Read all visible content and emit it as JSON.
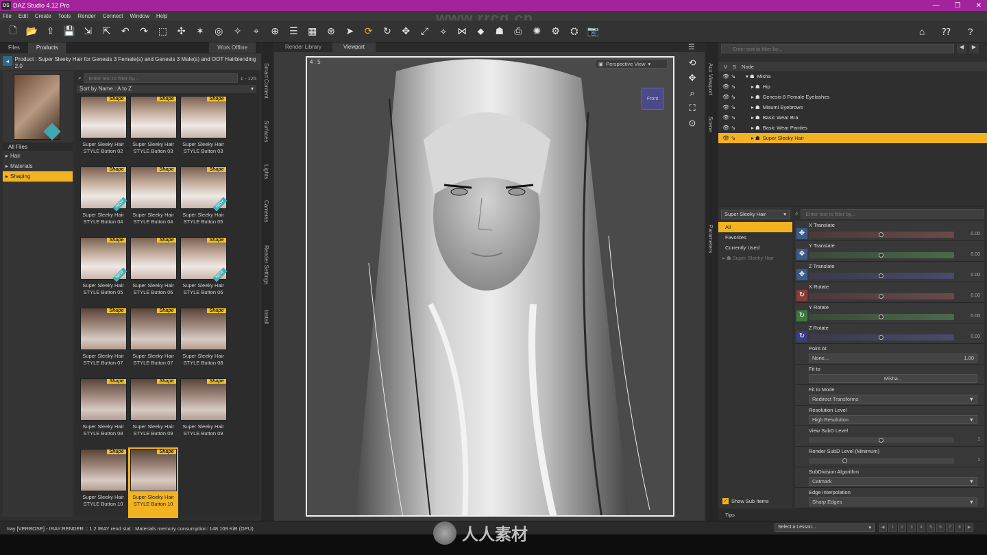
{
  "app": {
    "title": "DAZ Studio 4.12 Pro",
    "logo": "DS"
  },
  "window_controls": [
    "—",
    "❐",
    "✕"
  ],
  "menu": [
    "File",
    "Edit",
    "Create",
    "Tools",
    "Render",
    "Connect",
    "Window",
    "Help"
  ],
  "watermark_top": "www.rrcg.cn",
  "watermark_bottom": "人人素材",
  "left": {
    "tabs": [
      "Files",
      "Products",
      "Work Offline"
    ],
    "product_label": "Product :",
    "product_name": "Super Sleeky Hair for Genesis 3 Female(s) and Genesis 3 Male(s) and OOT Hairblending 2.0",
    "all_files": "All Files",
    "categories": [
      "Hair",
      "Materials",
      "Shaping"
    ],
    "filter_placeholder": "Enter text to filter by...",
    "count": "1 - 125",
    "sort": "Sort by Name : A to Z",
    "items": [
      {
        "label": "Super Sleeky Hair STYLE Button 02",
        "tag": "Shape",
        "new": false
      },
      {
        "label": "Super Sleeky Hair STYLE Button 03",
        "tag": "Shape",
        "new": false
      },
      {
        "label": "Super Sleeky Hair STYLE Button 03",
        "tag": "Shape",
        "new": false
      },
      {
        "label": "Super Sleeky Hair STYLE Button 04",
        "tag": "Shape",
        "new": true
      },
      {
        "label": "Super Sleeky Hair STYLE Button 04",
        "tag": "Shape",
        "new": false
      },
      {
        "label": "Super Sleeky Hair STYLE Button 05",
        "tag": "Shape",
        "new": true
      },
      {
        "label": "Super Sleeky Hair STYLE Button 05",
        "tag": "Shape",
        "new": true
      },
      {
        "label": "Super Sleeky Hair STYLE Button 06",
        "tag": "Shape",
        "new": false
      },
      {
        "label": "Super Sleeky Hair STYLE Button 06",
        "tag": "Shape",
        "new": true
      },
      {
        "label": "Super Sleeky Hair STYLE Button 07",
        "tag": "Shape",
        "new": false
      },
      {
        "label": "Super Sleeky Hair STYLE Button 07",
        "tag": "Shape",
        "new": false
      },
      {
        "label": "Super Sleeky Hair STYLE Button 08",
        "tag": "Shape",
        "new": false
      },
      {
        "label": "Super Sleeky Hair STYLE Button 08",
        "tag": "Shape",
        "new": false
      },
      {
        "label": "Super Sleeky Hair STYLE Button 09",
        "tag": "Shape",
        "new": false
      },
      {
        "label": "Super Sleeky Hair STYLE Button 09",
        "tag": "Shape",
        "new": false
      },
      {
        "label": "Super Sleeky Hair STYLE Button 10",
        "tag": "Shape",
        "new": false
      },
      {
        "label": "Super Sleeky Hair STYLE Button 10",
        "tag": "Shape",
        "new": false
      }
    ]
  },
  "side_tabs_left": [
    "Smart Content",
    "Surfaces",
    "Lights",
    "Cameras",
    "Render Settings",
    "Install"
  ],
  "viewport": {
    "tabs": [
      "Render Library",
      "Viewport"
    ],
    "ratio": "4 : 5",
    "view": "Perspective View",
    "cube_label": "Front"
  },
  "side_tabs_right": [
    "Aux Viewport",
    "Scene",
    "Parameters"
  ],
  "scene": {
    "filter_placeholder": "Enter text to filter by...",
    "header": [
      "V",
      "S",
      "Node"
    ],
    "nodes": [
      {
        "name": "Misha",
        "indent": 0,
        "selected": false
      },
      {
        "name": "Hip",
        "indent": 1,
        "selected": false
      },
      {
        "name": "Genesis 8 Female Eyelashes",
        "indent": 1,
        "selected": false
      },
      {
        "name": "Misumi Eyebrows",
        "indent": 1,
        "selected": false
      },
      {
        "name": "Basic Wear Bra",
        "indent": 1,
        "selected": false
      },
      {
        "name": "Basic Wear Panties",
        "indent": 1,
        "selected": false
      },
      {
        "name": "Super Sleeky Hair",
        "indent": 1,
        "selected": true
      }
    ]
  },
  "params": {
    "node_select": "Super Sleeky Hair",
    "groups": [
      "All",
      "Favorites",
      "Currently Used"
    ],
    "tree_node": "Super Sleeky Hair",
    "filter_placeholder": "Enter text to filter by...",
    "show_sub_items": "Show Sub Items",
    "props": [
      {
        "name": "X Translate",
        "kind": "slider",
        "icon": "translate",
        "track": "x",
        "value": "0.00",
        "knob": 0.5
      },
      {
        "name": "Y Translate",
        "kind": "slider",
        "icon": "translate",
        "track": "y",
        "value": "0.00",
        "knob": 0.5
      },
      {
        "name": "Z Translate",
        "kind": "slider",
        "icon": "translate",
        "track": "z",
        "value": "0.00",
        "knob": 0.5
      },
      {
        "name": "X Rotate",
        "kind": "slider",
        "icon": "rotate-x",
        "track": "x",
        "value": "0.00",
        "knob": 0.5
      },
      {
        "name": "Y Rotate",
        "kind": "slider",
        "icon": "rotate-y",
        "track": "y",
        "value": "0.00",
        "knob": 0.5
      },
      {
        "name": "Z Rotate",
        "kind": "slider",
        "icon": "rotate-z",
        "track": "z",
        "value": "0.00",
        "knob": 0.5
      },
      {
        "name": "Point At",
        "kind": "box",
        "value": "None...",
        "extra": "1.00"
      },
      {
        "name": "Fit to",
        "kind": "boxc",
        "value": "Misha..."
      },
      {
        "name": "Fit to Mode",
        "kind": "box",
        "value": "Redirect Transforms",
        "extra": "▼"
      },
      {
        "name": "Resolution Level",
        "kind": "box",
        "value": "High Resolution",
        "extra": "▼"
      },
      {
        "name": "View SubD Level",
        "kind": "slider",
        "icon": "",
        "track": "n",
        "value": "1",
        "knob": 0.5
      },
      {
        "name": "Render SubD Level (Minimum)",
        "kind": "slider",
        "icon": "",
        "track": "n",
        "value": "1",
        "knob": 0.25
      },
      {
        "name": "SubDivision Algorithm",
        "kind": "box",
        "value": "Catmark",
        "extra": "▼"
      },
      {
        "name": "Edge Interpolation",
        "kind": "box",
        "value": "Sharp Edges",
        "extra": "▼"
      }
    ]
  },
  "tips": "Tips",
  "status": "Iray [VERBOSE] - IRAY:RENDER ::   1.2   IRAY   rend stat : Materials memory consumption: 148.109 KiB (GPU)",
  "lesson": "Select a Lesson...",
  "colors": {
    "accent": "#f3b321",
    "titlebar": "#a3239a"
  }
}
